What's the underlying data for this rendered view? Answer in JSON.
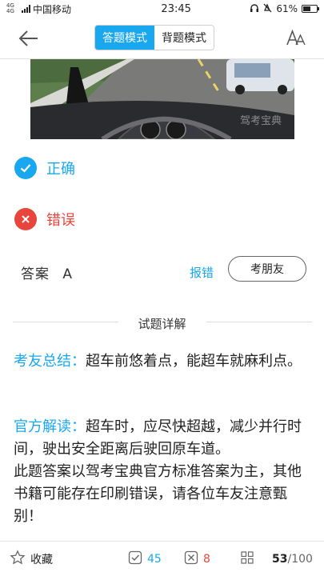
{
  "status_bar": {
    "signal_label": "4G 4G",
    "carrier": "中国移动",
    "time": "23:45",
    "battery": "61%",
    "battery_level": 0.61
  },
  "nav": {
    "mode_tabs": [
      "答题模式",
      "背题模式"
    ],
    "active_mode": 0
  },
  "image": {
    "watermark": "驾考宝典"
  },
  "options": [
    {
      "label": "正确",
      "state": "correct",
      "color": "#19a8f0"
    },
    {
      "label": "错误",
      "state": "wrong",
      "color": "#e8453c"
    }
  ],
  "answer": {
    "label": "答案",
    "value": "A",
    "report_link": "报错",
    "friend_button": "考朋友"
  },
  "detail": {
    "title": "试题详解",
    "summary_tag": "考友总结：",
    "summary_text": "超车前悠着点，能超车就麻利点。",
    "official_tag": "官方解读：",
    "official_text": "超车时，应尽快超越，减少并行时间，驶出安全距离后驶回原车道。",
    "disclaimer": "此题答案以驾考宝典官方标准答案为主，其他书籍可能存在印刷错误，请各位车友注意甄别！"
  },
  "bottom_bar": {
    "favorite_label": "收藏",
    "correct_count": "45",
    "wrong_count": "8",
    "current": "53",
    "total": "/100"
  },
  "colors": {
    "accent": "#19a8f0",
    "error": "#e8453c"
  }
}
